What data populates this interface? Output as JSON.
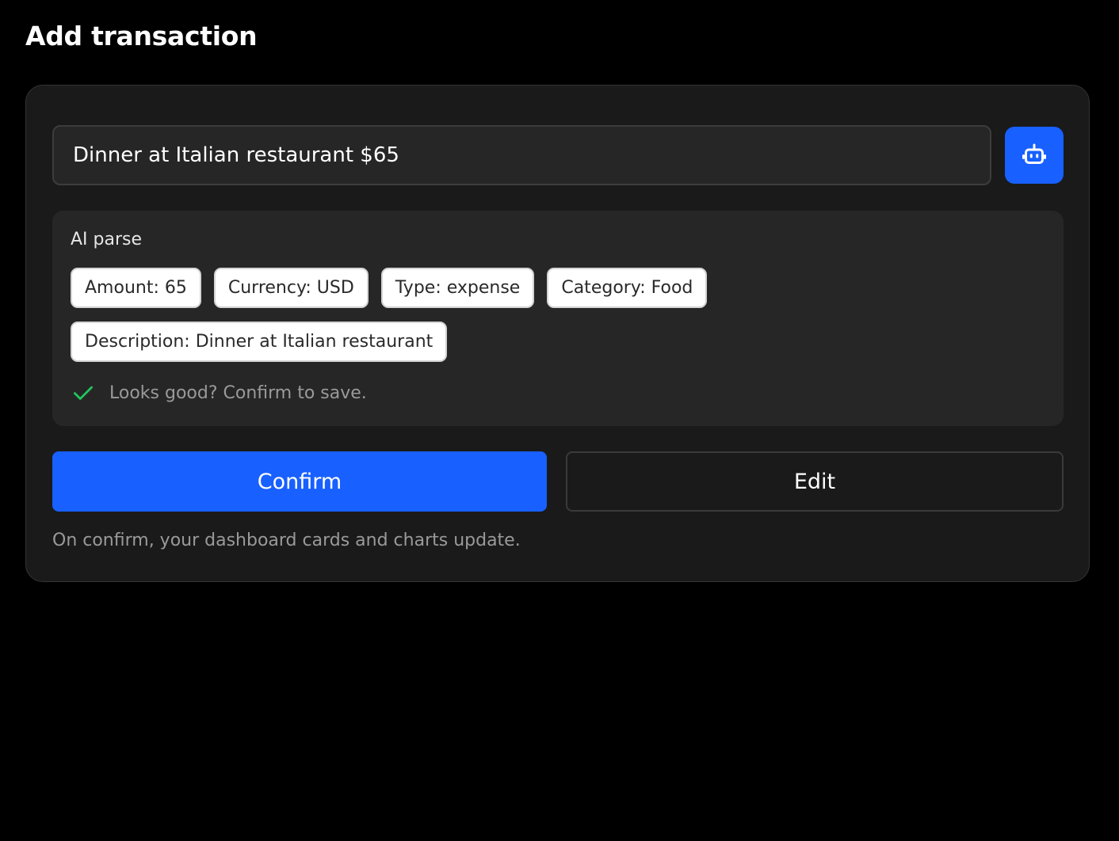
{
  "page": {
    "title": "Add transaction"
  },
  "input": {
    "value": "Dinner at Italian restaurant $65"
  },
  "ai_button": {
    "icon": "robot-icon"
  },
  "parse": {
    "heading": "AI parse",
    "chips": [
      "Amount: 65",
      "Currency: USD",
      "Type: expense",
      "Category: Food",
      "Description: Dinner at Italian restaurant"
    ],
    "status_icon": "check-icon",
    "status_text": "Looks good? Confirm to save."
  },
  "actions": {
    "confirm_label": "Confirm",
    "edit_label": "Edit"
  },
  "footnote": "On confirm, your dashboard cards and charts update.",
  "colors": {
    "background": "#000000",
    "card": "#1a1a1a",
    "accent": "#1860ff",
    "success": "#22c55e"
  }
}
